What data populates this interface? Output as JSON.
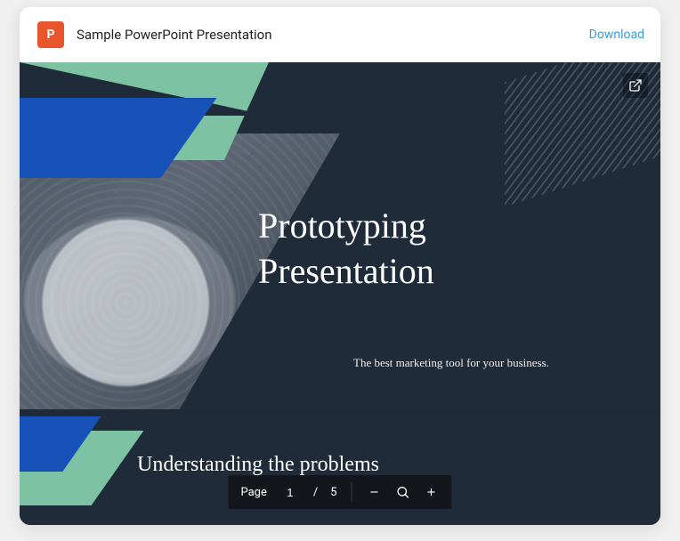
{
  "header": {
    "title": "Sample PowerPoint Presentation",
    "download_label": "Download",
    "app_icon_letter": "P"
  },
  "slide1": {
    "title_line1": "Prototyping",
    "title_line2": "Presentation",
    "subtitle": "The best marketing tool for your business."
  },
  "slide2": {
    "title": "Understanding the problems"
  },
  "pager": {
    "page_label": "Page",
    "current": "1",
    "separator": "/",
    "total": "5"
  }
}
